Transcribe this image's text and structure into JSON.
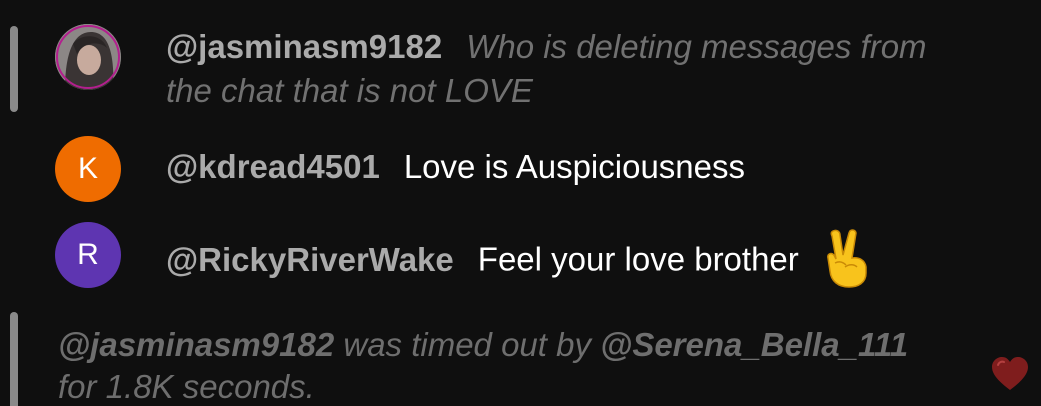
{
  "messages": [
    {
      "author": "@jasminasm9182",
      "text_line1": "Who is deleting messages from",
      "text_line2": "the chat that is not LOVE",
      "avatar_type": "photo",
      "deleted_style": true
    },
    {
      "author": "@kdread4501",
      "text": "Love is Auspiciousness",
      "avatar_letter": "K",
      "avatar_color": "#ef6c00"
    },
    {
      "author": "@RickyRiverWake",
      "text": "Feel your love brother",
      "avatar_letter": "R",
      "avatar_color": "#5e35b1",
      "emoji": "victory-hand-icon"
    }
  ],
  "system_message": {
    "user": "@jasminasm9182",
    "middle": " was timed out by ",
    "moderator": "@Serena_Bella_111",
    "line2": "for 1.8K seconds."
  },
  "colors": {
    "background": "#0f0f0f",
    "author": "#aaaaaa",
    "muted_text": "#717171",
    "heart": "#7f1d1d"
  }
}
